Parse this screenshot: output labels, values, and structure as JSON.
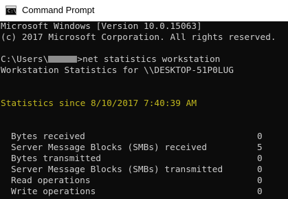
{
  "window": {
    "title": "Command Prompt",
    "icon": "cmd-icon",
    "icon_glyph": "C:\\"
  },
  "console": {
    "banner_line1": "Microsoft Windows [Version 10.0.15063]",
    "banner_line2": "(c) 2017 Microsoft Corporation. All rights reserved.",
    "prompt_prefix": "C:\\Users\\",
    "prompt_suffix": ">net statistics workstation",
    "heading": "Workstation Statistics for \\\\DESKTOP-51P0LUG",
    "since": "Statistics since 8/10/2017 7:40:39 AM",
    "stats": [
      {
        "label": "Bytes received",
        "value": "0"
      },
      {
        "label": "Server Message Blocks (SMBs) received",
        "value": "5"
      },
      {
        "label": "Bytes transmitted",
        "value": "0"
      },
      {
        "label": "Server Message Blocks (SMBs) transmitted",
        "value": "0"
      },
      {
        "label": "Read operations",
        "value": "0"
      },
      {
        "label": "Write operations",
        "value": "0"
      }
    ]
  },
  "colors": {
    "background": "#0c0c0c",
    "text": "#cccccc",
    "highlight": "#c1b71e",
    "redaction": "#8c8c8c"
  }
}
